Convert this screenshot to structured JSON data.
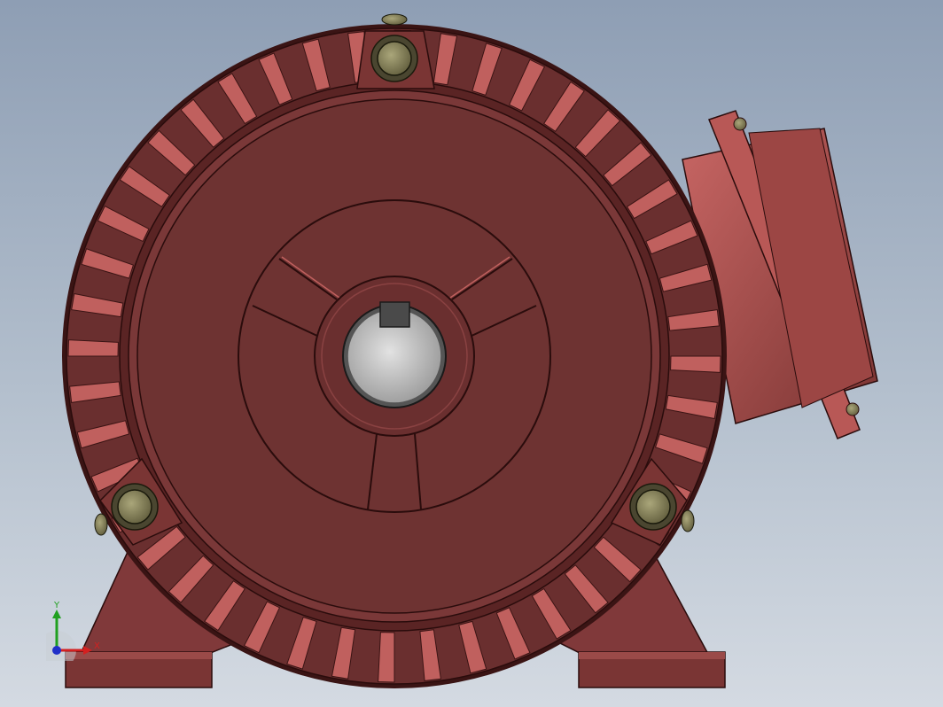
{
  "viewport": {
    "background_top": "#8e9eb4",
    "background_bottom": "#d4dae2"
  },
  "model": {
    "description_icon": "electric-motor-end-view",
    "body_color": "#6e3332",
    "body_light": "#c0605e",
    "body_dark": "#3a1414",
    "shaft_color": "#c8c8c8",
    "bolt_color": "#8a8660"
  },
  "triad": {
    "x_label": "X",
    "y_label": "Y",
    "x_color": "#d42020",
    "y_color": "#20a020",
    "z_color": "#2030c8"
  }
}
